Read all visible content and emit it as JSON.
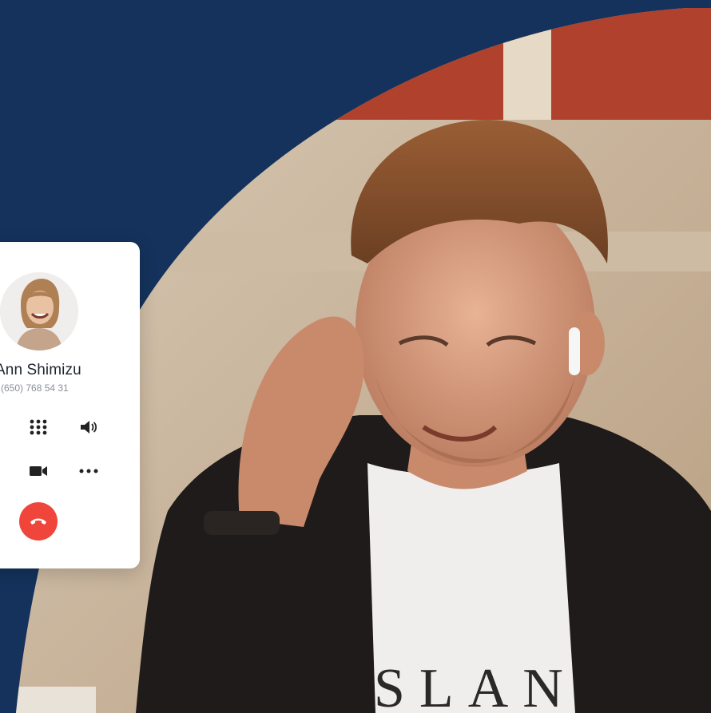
{
  "contact": {
    "name": "Ann Shimizu",
    "phone": "(650) 768 54 31",
    "avatar_icon": "avatar-photo"
  },
  "controls": [
    {
      "name": "keypad",
      "icon": "keypad-icon"
    },
    {
      "name": "speaker",
      "icon": "speaker-icon"
    },
    {
      "name": "video",
      "icon": "video-camera-icon"
    },
    {
      "name": "more",
      "icon": "more-dots-icon"
    }
  ],
  "hangup": {
    "icon": "phone-hangup-icon"
  },
  "photo": {
    "shirt_text": "SLAN"
  },
  "colors": {
    "background": "#14325c",
    "card": "#ffffff",
    "hangup": "#f0453a",
    "icon": "#222222"
  }
}
